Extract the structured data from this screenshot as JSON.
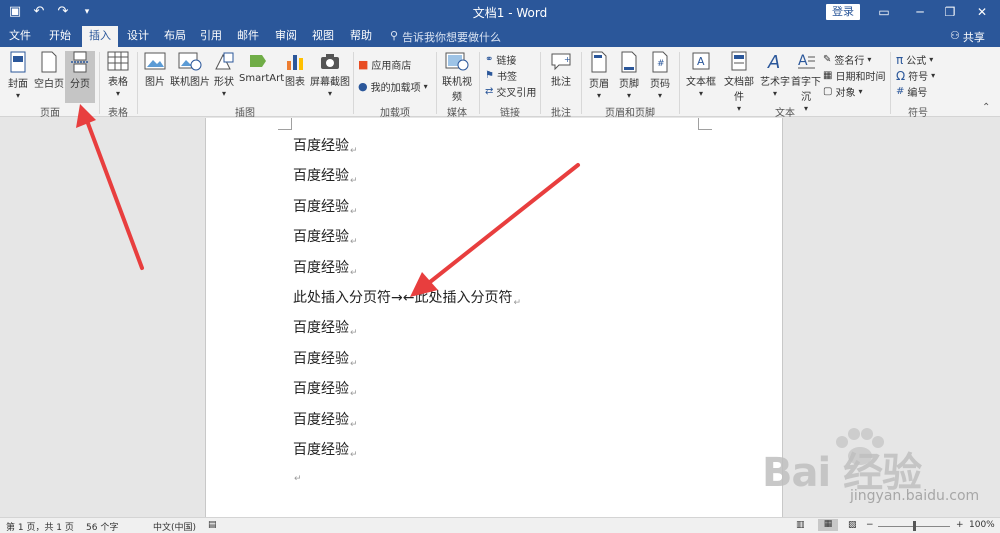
{
  "titlebar": {
    "doc_title": "文档1  -  Word",
    "login": "登录"
  },
  "tabs": [
    {
      "label": "文件"
    },
    {
      "label": "开始"
    },
    {
      "label": "插入"
    },
    {
      "label": "设计"
    },
    {
      "label": "布局"
    },
    {
      "label": "引用"
    },
    {
      "label": "邮件"
    },
    {
      "label": "审阅"
    },
    {
      "label": "视图"
    },
    {
      "label": "帮助"
    }
  ],
  "active_tab": "插入",
  "tellme": "告诉我你想要做什么",
  "share": "共享",
  "ribbon": {
    "pages": {
      "cover": "封面",
      "blank": "空白页",
      "break": "分页",
      "group": "页面"
    },
    "tables": {
      "table": "表格",
      "group": "表格"
    },
    "illustrations": {
      "picture": "图片",
      "online_picture": "联机图片",
      "shapes": "形状",
      "smartart": "SmartArt",
      "chart": "图表",
      "screenshot": "屏幕截图",
      "group": "插图"
    },
    "addins": {
      "store": "应用商店",
      "my_addins": "我的加载项",
      "group": "加载项"
    },
    "media": {
      "online_video": "联机视频",
      "group": "媒体"
    },
    "links": {
      "link": "链接",
      "bookmark": "书签",
      "cross_ref": "交叉引用",
      "group": "链接"
    },
    "comments": {
      "comment": "批注",
      "group": "批注"
    },
    "header_footer": {
      "header": "页眉",
      "footer": "页脚",
      "page_num": "页码",
      "group": "页眉和页脚"
    },
    "text": {
      "textbox": "文本框",
      "quick_parts": "文档部件",
      "wordart": "艺术字",
      "dropcap": "首字下沉",
      "signature": "签名行",
      "datetime": "日期和时间",
      "object": "对象",
      "group": "文本"
    },
    "symbols": {
      "equation": "公式",
      "symbol": "符号",
      "number": "编号",
      "group": "符号"
    }
  },
  "document": {
    "lines": [
      "百度经验",
      "百度经验",
      "百度经验",
      "百度经验",
      "百度经验",
      "此处插入分页符→←此处插入分页符",
      "百度经验",
      "百度经验",
      "百度经验",
      "百度经验",
      "百度经验"
    ],
    "para_mark": "↵"
  },
  "statusbar": {
    "page": "第 1 页，共 1 页",
    "words": "56 个字",
    "language": "中文(中国)",
    "zoom": "100%"
  },
  "watermark": {
    "main": "Bai 经验",
    "sub": "jingyan.baidu.com"
  },
  "colors": {
    "accent": "#2b579a",
    "arrow": "#e83e3e",
    "icon_blue": "#2b579a"
  }
}
